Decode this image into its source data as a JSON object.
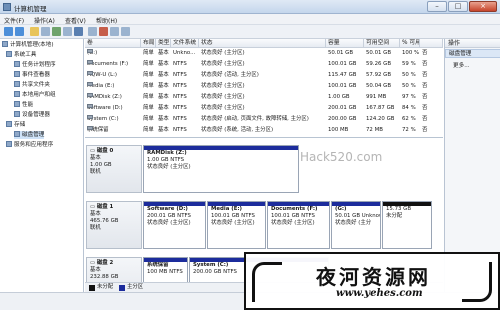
{
  "window": {
    "title": "计算机管理",
    "min": "–",
    "max": "□",
    "close": "×"
  },
  "menu": [
    "文件(F)",
    "操作(A)",
    "查看(V)",
    "帮助(H)"
  ],
  "tree": [
    {
      "label": "计算机管理(本地)",
      "icon": "computer-icon"
    },
    {
      "label": "系统工具",
      "icon": "tools-icon"
    },
    {
      "label": "任务计划程序",
      "icon": "clock-icon"
    },
    {
      "label": "事件查看器",
      "icon": "event-icon"
    },
    {
      "label": "共享文件夹",
      "icon": "folder-icon"
    },
    {
      "label": "本地用户和组",
      "icon": "users-icon"
    },
    {
      "label": "性能",
      "icon": "performance-icon"
    },
    {
      "label": "设备管理器",
      "icon": "device-icon"
    },
    {
      "label": "存储",
      "icon": "storage-icon"
    },
    {
      "label": "磁盘管理",
      "icon": "disk-icon"
    },
    {
      "label": "服务和应用程序",
      "icon": "services-icon"
    }
  ],
  "volumes": {
    "headers": [
      "卷",
      "布局",
      "类型",
      "文件系统",
      "状态",
      "容量",
      "可用空间",
      "% 可用",
      ""
    ],
    "rows": [
      [
        "(G:)",
        "简单",
        "基本",
        "Unkno...",
        "状态良好 (主分区)",
        "50.01 GB",
        "50.01 GB",
        "100 %",
        "否"
      ],
      [
        "Documents (F:)",
        "简单",
        "基本",
        "NTFS",
        "状态良好 (主分区)",
        "100.01 GB",
        "59.26 GB",
        "59 %",
        "否"
      ],
      [
        "HQW-U (L:)",
        "简单",
        "基本",
        "NTFS",
        "状态良好 (活动, 主分区)",
        "115.47 GB",
        "57.92 GB",
        "50 %",
        "否"
      ],
      [
        "Media (E:)",
        "简单",
        "基本",
        "NTFS",
        "状态良好 (主分区)",
        "100.01 GB",
        "50.04 GB",
        "50 %",
        "否"
      ],
      [
        "RAMDisk (Z:)",
        "简单",
        "基本",
        "NTFS",
        "状态良好 (主分区)",
        "1.00 GB",
        "991 MB",
        "97 %",
        "否"
      ],
      [
        "Software (D:)",
        "简单",
        "基本",
        "NTFS",
        "状态良好 (主分区)",
        "200.01 GB",
        "167.87 GB",
        "84 %",
        "否"
      ],
      [
        "System (C:)",
        "简单",
        "基本",
        "NTFS",
        "状态良好 (启动, 页面文件, 故障转储, 主分区)",
        "200.00 GB",
        "124.20 GB",
        "62 %",
        "否"
      ],
      [
        "系统保留",
        "简单",
        "基本",
        "NTFS",
        "状态良好 (系统, 活动, 主分区)",
        "100 MB",
        "72 MB",
        "72 %",
        "否"
      ]
    ]
  },
  "disks": [
    {
      "name": "磁盘 0",
      "type": "基本",
      "size": "1.00 GB",
      "state": "联机",
      "partitions": [
        {
          "name": "RAMDisk  (Z:)",
          "size": "1.00 GB NTFS",
          "status": "状态良好 (主分区)"
        }
      ]
    },
    {
      "name": "磁盘 1",
      "type": "基本",
      "size": "465.76 GB",
      "state": "联机",
      "partitions": [
        {
          "name": "Software  (D:)",
          "size": "200.01 GB NTFS",
          "status": "状态良好 (主分区)"
        },
        {
          "name": "Media  (E:)",
          "size": "100.01 GB NTFS",
          "status": "状态良好 (主分区)"
        },
        {
          "name": "Documents  (F:)",
          "size": "100.01 GB NTFS",
          "status": "状态良好 (主分区)"
        },
        {
          "name": "(G:)",
          "size": "50.01 GB Unknow",
          "status": "状态良好 (主分"
        },
        {
          "name": "",
          "size": "15.73 GB",
          "status": "未分配"
        }
      ]
    },
    {
      "name": "磁盘 2",
      "type": "基本",
      "size": "232.88 GB",
      "state": "",
      "partitions": [
        {
          "name": "系统保留",
          "size": "100 MB NTFS",
          "status": ""
        },
        {
          "name": "System  (C:)",
          "size": "200.00 GB NTFS",
          "status": ""
        }
      ]
    }
  ],
  "legend": [
    {
      "label": "未分配",
      "color": "#111111"
    },
    {
      "label": "主分区",
      "color": "#1c2c9c"
    }
  ],
  "actions": {
    "header": "操作",
    "section": "磁盘管理",
    "more": "更多..."
  },
  "watermarks": {
    "hack": "Hack520.com",
    "cn": "夜河资源网",
    "url": "www.yehes.com"
  }
}
